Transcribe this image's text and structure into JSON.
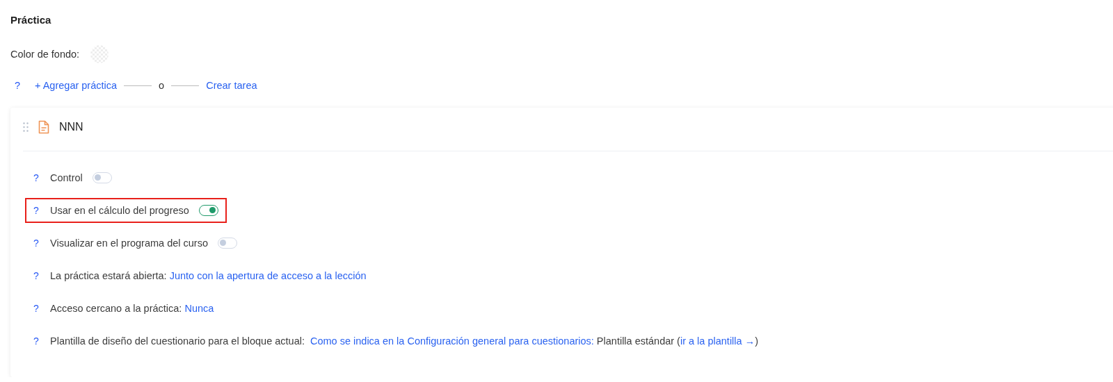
{
  "section_title": "Práctica",
  "background_color": {
    "label": "Color de fondo:"
  },
  "add_row": {
    "help": "?",
    "add_link": "+ Agregar práctica",
    "separator": "o",
    "create_link": "Crear tarea"
  },
  "card": {
    "title": "NNN",
    "settings": [
      {
        "kind": "toggle",
        "help": "?",
        "label": "Control",
        "on": false,
        "highlighted": false
      },
      {
        "kind": "toggle",
        "help": "?",
        "label": "Usar en el cálculo del progreso",
        "on": true,
        "highlighted": true
      },
      {
        "kind": "toggle",
        "help": "?",
        "label": "Visualizar en el programa del curso",
        "on": false,
        "highlighted": false
      },
      {
        "kind": "text",
        "help": "?",
        "highlighted": false,
        "parts": [
          {
            "kind": "plain",
            "text": "La práctica estará abierta:"
          },
          {
            "kind": "link",
            "text": "Junto con la apertura de acceso a la lección"
          }
        ]
      },
      {
        "kind": "text",
        "help": "?",
        "highlighted": false,
        "parts": [
          {
            "kind": "plain",
            "text": "Acceso cercano a la práctica:"
          },
          {
            "kind": "link",
            "text": "Nunca"
          }
        ]
      },
      {
        "kind": "text",
        "help": "?",
        "highlighted": false,
        "parts": [
          {
            "kind": "plain",
            "text": "Plantilla de diseño del cuestionario para el bloque actual: "
          },
          {
            "kind": "link",
            "text": "Como se indica en la Configuración general para cuestionarios:"
          },
          {
            "kind": "plain",
            "text": "Plantilla estándar ("
          },
          {
            "kind": "link",
            "text": "ir a la plantilla →"
          },
          {
            "kind": "plain",
            "text": ")"
          }
        ]
      }
    ]
  }
}
